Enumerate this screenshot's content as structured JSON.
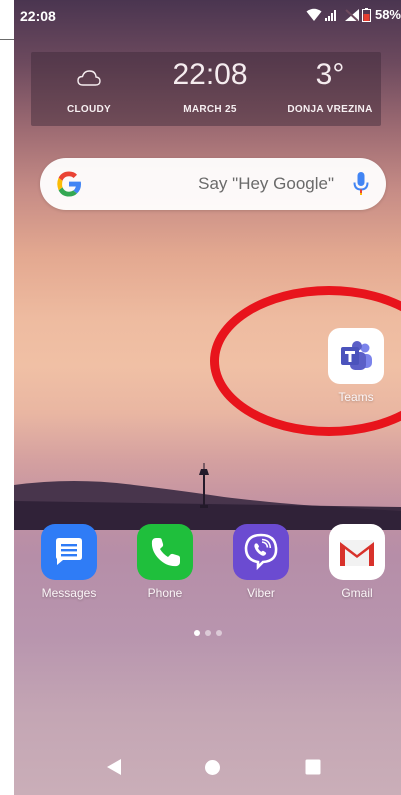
{
  "status_bar": {
    "time": "22:08",
    "battery_percent": "58%",
    "icons": [
      "wifi-icon",
      "signal-icon",
      "no-sim-icon",
      "battery-icon"
    ]
  },
  "weather": {
    "condition_icon": "cloud-icon",
    "condition": "CLOUDY",
    "time": "22:08",
    "date": "MARCH 25",
    "temperature": "3°",
    "location": "DONJA VREZINA"
  },
  "search": {
    "hint": "Say \"Hey Google\"",
    "icons": [
      "google-g-icon",
      "mic-icon"
    ]
  },
  "apps": {
    "teams": {
      "label": "Teams",
      "icon": "microsoft-teams-icon"
    }
  },
  "dock": [
    {
      "label": "Messages",
      "icon": "messages-icon",
      "color": "#2f7cf6"
    },
    {
      "label": "Phone",
      "icon": "phone-icon",
      "color": "#1fbf3c"
    },
    {
      "label": "Viber",
      "icon": "viber-icon",
      "color": "#6b4bd1"
    },
    {
      "label": "Gmail",
      "icon": "gmail-icon",
      "color": "#ffffff"
    }
  ],
  "page_indicator": {
    "pages": 3,
    "active": 1
  },
  "nav": {
    "icons": [
      "back-icon",
      "home-icon",
      "recents-icon"
    ]
  },
  "colors": {
    "annotation": "#e8141c",
    "teams_purple": "#5b5fc7"
  }
}
